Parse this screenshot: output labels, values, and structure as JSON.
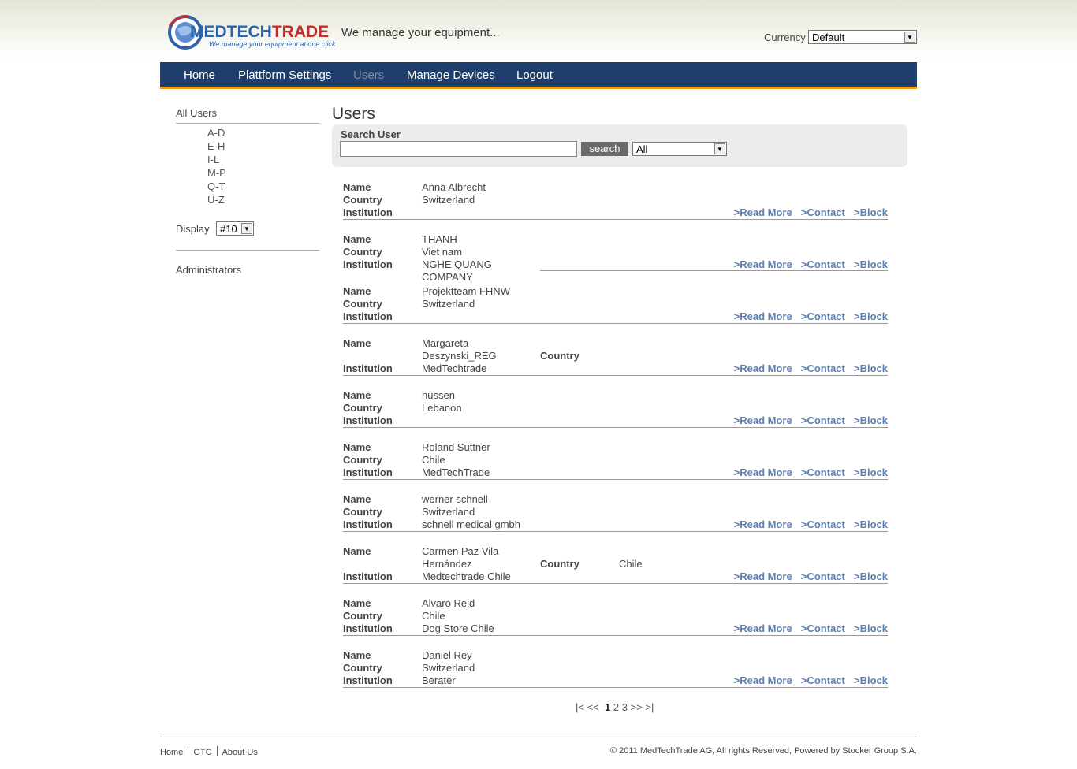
{
  "header": {
    "logo_main": "MEDTECH",
    "logo_trade": "TRADE",
    "logo_sub": "We manage your equipment at one click",
    "tagline": "We manage your equipment...",
    "currency_label": "Currency",
    "currency_value": "Default"
  },
  "nav": {
    "home": "Home",
    "settings": "Plattform Settings",
    "users": "Users",
    "devices": "Manage Devices",
    "logout": "Logout"
  },
  "sidebar": {
    "all_users": "All Users",
    "letters": [
      "A-D",
      "E-H",
      "I-L",
      "M-P",
      "Q-T",
      "U-Z"
    ],
    "display_label": "Display",
    "display_value": "#10",
    "administrators": "Administrators"
  },
  "main": {
    "title": "Users",
    "search_label": "Search User",
    "search_value": "",
    "search_button": "search",
    "filter_value": "All"
  },
  "labels": {
    "name": "Name",
    "country": "Country",
    "institution": "Institution",
    "read_more": ">Read More",
    "contact": ">Contact",
    "block": ">Block"
  },
  "users": [
    {
      "name": "Anna Albrecht",
      "country": "Switzerland",
      "institution": ""
    },
    {
      "name": "THANH",
      "country": "Viet nam",
      "institution_1": "NGHE QUANG",
      "institution_2": "COMPANY"
    },
    {
      "name": "Projektteam FHNW",
      "country": "Switzerland",
      "institution": ""
    },
    {
      "name_1": "Margareta",
      "name_2": "Deszynski_REG",
      "country": "",
      "institution": "MedTechtrade"
    },
    {
      "name": "hussen",
      "country": "Lebanon",
      "institution": ""
    },
    {
      "name": "Roland Suttner",
      "country": "Chile",
      "institution": "MedTechTrade"
    },
    {
      "name": "werner schnell",
      "country": "Switzerland",
      "institution": "schnell medical gmbh"
    },
    {
      "name_1": "Carmen Paz Vila",
      "name_2": "Hernández",
      "country": "Chile",
      "institution": "Medtechtrade Chile"
    },
    {
      "name": "Alvaro Reid",
      "country": "Chile",
      "institution": "Dog Store Chile"
    },
    {
      "name": "Daniel Rey",
      "country": "Switzerland",
      "institution": "Berater"
    }
  ],
  "pager": {
    "first": "|<",
    "prev": "<<",
    "pages": [
      "1",
      "2",
      "3"
    ],
    "next": ">>",
    "last": ">|"
  },
  "footer": {
    "links": [
      "Home",
      "GTC",
      "About Us"
    ],
    "copyright": "© 2011 MedTechTrade AG, All rights Reserved, Powered by Stocker Group S.A."
  },
  "colors": {
    "nav_bg": "#1e3e6c",
    "nav_accent": "#f09a1a",
    "link": "#5b7fb3",
    "logo_blue": "#2e63a7",
    "logo_red": "#c42d2d"
  }
}
